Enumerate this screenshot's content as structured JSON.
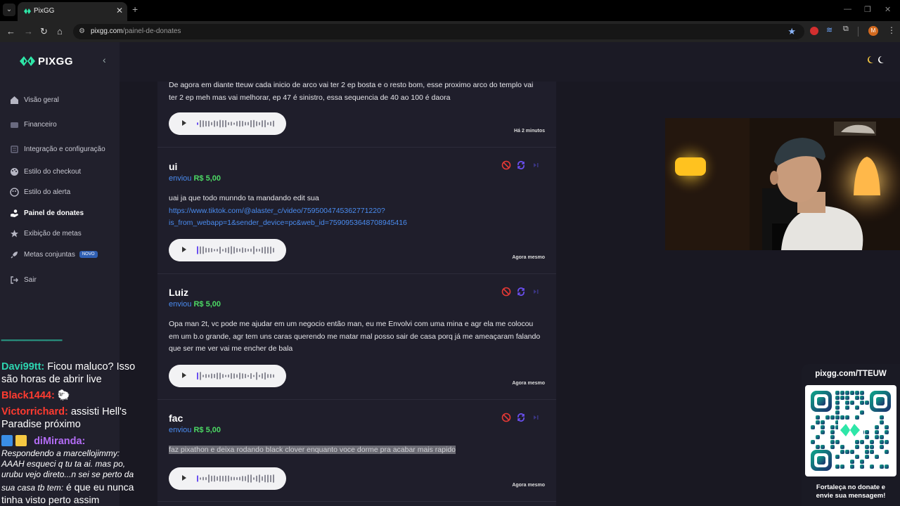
{
  "browser": {
    "tab_title": "PixGG",
    "url_host": "pixgg.com",
    "url_path": "/painel-de-donates",
    "profile_initial": "M"
  },
  "sidebar": {
    "logo_text": "PIXGG",
    "items": [
      {
        "label": "Visão geral",
        "icon": "home-icon"
      },
      {
        "label": "Financeiro",
        "icon": "wallet-icon"
      },
      {
        "label": "Integração e configuração",
        "icon": "settings-icon"
      },
      {
        "label": "Estilo do checkout",
        "icon": "palette-icon"
      },
      {
        "label": "Estilo do alerta",
        "icon": "palette-icon"
      },
      {
        "label": "Painel de donates",
        "icon": "donate-icon",
        "active": true
      },
      {
        "label": "Exibição de metas",
        "icon": "star-icon"
      },
      {
        "label": "Metas conjuntas",
        "icon": "rocket-icon",
        "badge": "NOVO"
      },
      {
        "label": "Sair",
        "icon": "logout-icon"
      }
    ]
  },
  "donations": [
    {
      "name": "",
      "sent_label": "",
      "amount": "",
      "message": "De agora em diante tteuw cada inicio de arco vai ter 2 ep bosta e o resto bom, esse proximo arco do templo vai ter 2 ep meh mas vai melhorar, ep 47 é sinistro, essa sequencia de 40 ao 100 é daora",
      "time": "Há 2 minutos"
    },
    {
      "name": "ui",
      "sent_label": "enviou",
      "amount": "R$ 5,00",
      "message": "uai ja que todo munndo ta mandando edit sua",
      "link": "https://www.tiktok.com/@alaster_c/video/7595004745362771220?is_from_webapp=1&sender_device=pc&web_id=7590953648708945416",
      "link_line1": "https://www.tiktok.com/@alaster_c/video/7595004745362771220?",
      "link_line2": "is_from_webapp=1&sender_device=pc&web_id=7590953648708945416",
      "time": "Agora mesmo"
    },
    {
      "name": "Luiz",
      "sent_label": "enviou",
      "amount": "R$ 5,00",
      "message": "Opa man 2t, vc pode me ajudar em um negocio então man, eu me Envolvi com uma mina e agr ela me colocou em um b.o grande, agr tem uns caras querendo me matar mal posso sair de casa porq já me ameaçaram falando que ser me ver vai me encher de bala",
      "time": "Agora mesmo"
    },
    {
      "name": "fac",
      "sent_label": "enviou",
      "amount": "R$ 5,00",
      "message": "faz pixathon e deixa rodando black clover enquanto voce dorme pra acabar mais rapido",
      "time": "Agora mesmo"
    }
  ],
  "chat": {
    "lines": [
      {
        "user": "Davi99tt:",
        "text": "Ficou maluco? Isso"
      },
      {
        "text": "são horas de abrir live"
      },
      {
        "user": "Black1444:",
        "text": "🐑"
      },
      {
        "user": "Victorrichard:",
        "text": "assisti Hell's"
      },
      {
        "text": "Paradise próximo"
      },
      {
        "user": "diMiranda:"
      },
      {
        "text": "Respondendo a marcellojimmy:"
      },
      {
        "text": "AAAH esqueci q tu ta ai. mas po,"
      },
      {
        "text": "urubu vejo direto...n sei se perto da"
      },
      {
        "text": "sua casa tb tem:",
        "tail": "é que eu nunca"
      },
      {
        "text": "tinha visto perto assim"
      }
    ]
  },
  "qr": {
    "title": "pixgg.com/TTEUW",
    "footer_line1": "Fortaleça no donate e",
    "footer_line2": "envie sua mensagem!"
  },
  "colors": {
    "accent_blue": "#4a8cf0",
    "amount_green": "#4cd964",
    "logo_green": "#2ee6a8"
  }
}
